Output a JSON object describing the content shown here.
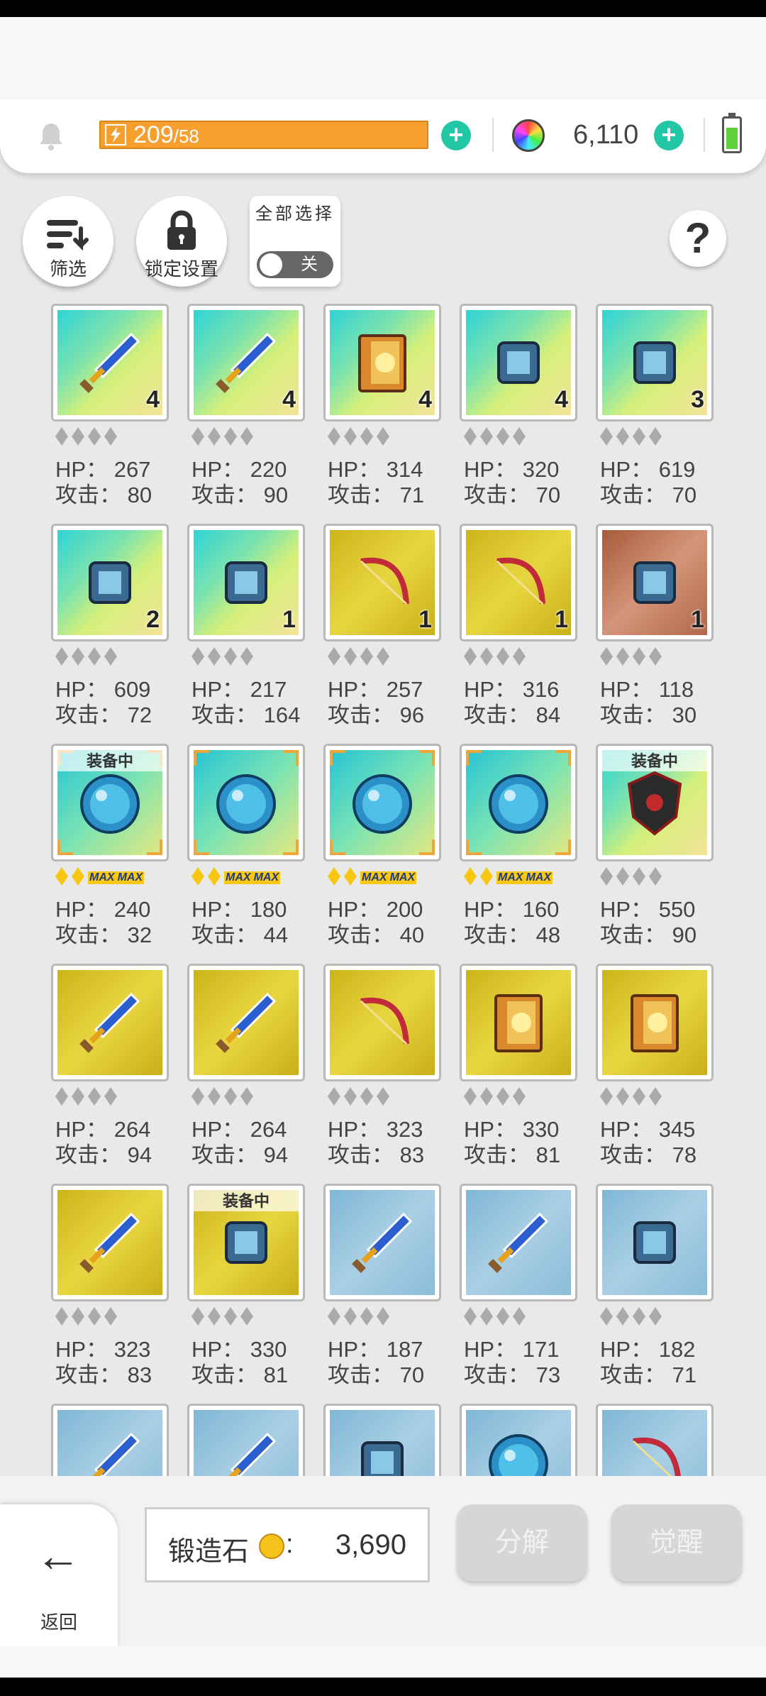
{
  "header": {
    "energy_current": "209",
    "energy_max": "/58",
    "gems": "6,110",
    "colors": {
      "energy": "#f7a030",
      "plus": "#22c7a5",
      "battery": "#5fcf3a"
    }
  },
  "toolbar": {
    "filter_label": "筛选",
    "lock_label": "锁定设置",
    "select_all_label": "全部选择",
    "toggle_state": "关",
    "help_label": "?"
  },
  "stat_labels": {
    "hp": "HP：",
    "atk": "攻击："
  },
  "equipped_label": "装备中",
  "items": [
    {
      "icon": "sword-icon",
      "bg": "rainbow",
      "count": "4",
      "hp": "267",
      "atk": "80",
      "stars": "grey"
    },
    {
      "icon": "spear-icon",
      "bg": "rainbow",
      "count": "4",
      "hp": "220",
      "atk": "90",
      "stars": "grey"
    },
    {
      "icon": "book-icon",
      "bg": "rainbow",
      "count": "4",
      "hp": "314",
      "atk": "71",
      "stars": "grey"
    },
    {
      "icon": "belt-icon",
      "bg": "rainbow",
      "count": "4",
      "hp": "320",
      "atk": "70",
      "stars": "grey"
    },
    {
      "icon": "gauntlet-icon",
      "bg": "rainbow",
      "count": "3",
      "hp": "619",
      "atk": "70",
      "stars": "grey"
    },
    {
      "icon": "potion-necklace-icon",
      "bg": "rainbow",
      "count": "2",
      "hp": "609",
      "atk": "72",
      "stars": "grey"
    },
    {
      "icon": "armor-icon",
      "bg": "rainbow",
      "count": "1",
      "hp": "217",
      "atk": "164",
      "stars": "grey"
    },
    {
      "icon": "crossbow-icon",
      "bg": "gold",
      "count": "1",
      "hp": "257",
      "atk": "96",
      "stars": "grey"
    },
    {
      "icon": "bow-icon",
      "bg": "gold",
      "count": "1",
      "hp": "316",
      "atk": "84",
      "stars": "grey"
    },
    {
      "icon": "boots-icon",
      "bg": "bronze",
      "count": "1",
      "hp": "118",
      "atk": "30",
      "stars": "grey"
    },
    {
      "icon": "green-orb-icon",
      "bg": "orb",
      "count": "",
      "hp": "240",
      "atk": "32",
      "stars": "max",
      "equipped": true
    },
    {
      "icon": "gold-orb-icon",
      "bg": "orb",
      "count": "",
      "hp": "180",
      "atk": "44",
      "stars": "max"
    },
    {
      "icon": "blue-orb-icon",
      "bg": "orb",
      "count": "",
      "hp": "200",
      "atk": "40",
      "stars": "max"
    },
    {
      "icon": "earth-orb-icon",
      "bg": "orb",
      "count": "",
      "hp": "160",
      "atk": "48",
      "stars": "max"
    },
    {
      "icon": "shield-icon",
      "bg": "rainbow",
      "count": "",
      "hp": "550",
      "atk": "90",
      "stars": "grey",
      "equipped": true
    },
    {
      "icon": "greatsword-icon",
      "bg": "gold",
      "count": "",
      "hp": "264",
      "atk": "94",
      "stars": "grey"
    },
    {
      "icon": "lance-icon",
      "bg": "gold",
      "count": "",
      "hp": "264",
      "atk": "94",
      "stars": "grey"
    },
    {
      "icon": "red-bow-icon",
      "bg": "gold",
      "count": "",
      "hp": "323",
      "atk": "83",
      "stars": "grey"
    },
    {
      "icon": "tome-icon",
      "bg": "gold",
      "count": "",
      "hp": "330",
      "atk": "81",
      "stars": "grey"
    },
    {
      "icon": "dark-book-icon",
      "bg": "gold",
      "count": "",
      "hp": "345",
      "atk": "78",
      "stars": "grey"
    },
    {
      "icon": "staff-icon",
      "bg": "gold",
      "count": "",
      "hp": "323",
      "atk": "83",
      "stars": "grey"
    },
    {
      "icon": "glove-icon",
      "bg": "gold",
      "count": "",
      "hp": "330",
      "atk": "81",
      "stars": "grey",
      "equipped": true
    },
    {
      "icon": "dagger-icon",
      "bg": "blue",
      "count": "",
      "hp": "187",
      "atk": "70",
      "stars": "grey"
    },
    {
      "icon": "lightning-sword-icon",
      "bg": "blue",
      "count": "",
      "hp": "171",
      "atk": "73",
      "stars": "grey"
    },
    {
      "icon": "axe-icon",
      "bg": "blue",
      "count": "",
      "hp": "182",
      "atk": "71",
      "stars": "grey"
    },
    {
      "icon": "katana-icon",
      "bg": "blue",
      "count": "",
      "hp": "",
      "atk": "",
      "stars": "none"
    },
    {
      "icon": "scythe-icon",
      "bg": "blue",
      "count": "",
      "hp": "",
      "atk": "",
      "stars": "none"
    },
    {
      "icon": "claw-icon",
      "bg": "blue",
      "count": "",
      "hp": "",
      "atk": "",
      "stars": "none"
    },
    {
      "icon": "chakram-icon",
      "bg": "blue",
      "count": "",
      "hp": "",
      "atk": "",
      "stars": "none"
    },
    {
      "icon": "crystal-bow-icon",
      "bg": "blue",
      "count": "",
      "hp": "",
      "atk": "",
      "stars": "none"
    }
  ],
  "bottom": {
    "back_label": "返回",
    "forge_label": "锻造石",
    "forge_colon": ":",
    "forge_value": "3,690",
    "decompose_label": "分解",
    "awaken_label": "觉醒"
  }
}
